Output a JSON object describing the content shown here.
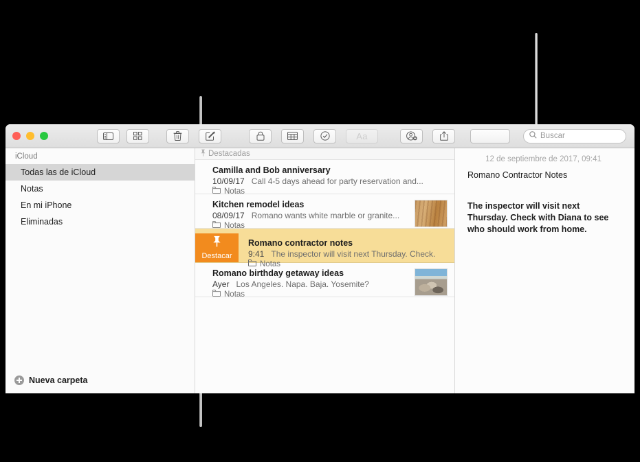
{
  "window": {
    "traffic_lights": [
      {
        "name": "close",
        "color": "#ff5f57"
      },
      {
        "name": "minimize",
        "color": "#ffbd2e"
      },
      {
        "name": "zoom",
        "color": "#28c840"
      }
    ]
  },
  "toolbar": {
    "buttons": [
      {
        "name": "sidebar-toggle",
        "icon": "sidebar-icon",
        "label": ""
      },
      {
        "name": "gallery-view",
        "icon": "grid-icon",
        "label": ""
      },
      {
        "name": "delete-note",
        "icon": "trash-icon",
        "label": ""
      },
      {
        "name": "new-note",
        "icon": "compose-icon",
        "label": ""
      },
      {
        "name": "lock-note",
        "icon": "lock-icon",
        "label": ""
      },
      {
        "name": "add-table",
        "icon": "table-icon",
        "label": ""
      },
      {
        "name": "checklist",
        "icon": "checkmark-circle-icon",
        "label": ""
      },
      {
        "name": "format",
        "icon": "aa-icon",
        "label": "Aa"
      },
      {
        "name": "add-people",
        "icon": "add-person-icon",
        "label": ""
      },
      {
        "name": "share",
        "icon": "share-icon",
        "label": ""
      },
      {
        "name": "blank",
        "icon": "blank-icon",
        "label": ""
      }
    ],
    "search": {
      "placeholder": "Buscar",
      "value": "",
      "icon": "search-icon"
    }
  },
  "sidebar": {
    "header": "iCloud",
    "items": [
      {
        "label": "Todas las de iCloud",
        "selected": true
      },
      {
        "label": "Notas",
        "selected": false
      },
      {
        "label": "En mi iPhone",
        "selected": false
      },
      {
        "label": "Eliminadas",
        "selected": false
      }
    ],
    "new_folder": {
      "label": "Nueva carpeta",
      "icon": "plus-circle-icon"
    }
  },
  "notes_list": {
    "header": {
      "label": "Destacadas",
      "icon": "pin-icon"
    },
    "notes": [
      {
        "title": "Camilla and Bob anniversary",
        "date": "10/09/17",
        "preview": "Call 4-5 days ahead for party reservation and...",
        "folder": "Notas",
        "folder_icon": "folder-icon",
        "thumbnail": null,
        "pinned": false
      },
      {
        "title": "Kitchen remodel ideas",
        "date": "08/09/17",
        "preview": "Romano wants white marble or granite...",
        "folder": "Notas",
        "folder_icon": "folder-icon",
        "thumbnail": "wood",
        "pinned": false
      },
      {
        "title": "Romano contractor notes",
        "date": "9:41",
        "preview": "The inspector will visit next Thursday. Check.",
        "folder": "Notas",
        "folder_icon": "folder-icon",
        "thumbnail": null,
        "pinned": true,
        "pin_action_label": "Destacar",
        "pin_action_icon": "pin-icon",
        "pin_action_color": "#f28b1e",
        "row_color": "#f7dd98"
      },
      {
        "title": "Romano birthday getaway ideas",
        "date": "Ayer",
        "preview": "Los Angeles. Napa. Baja. Yosemite?",
        "folder": "Notas",
        "folder_icon": "folder-icon",
        "thumbnail": "beach",
        "pinned": false
      }
    ]
  },
  "detail": {
    "date": "12 de septiembre de 2017, 09:41",
    "title": "Romano Contractor Notes",
    "body": "The inspector will visit next Thursday. Check with Diana to see who should work from home."
  }
}
